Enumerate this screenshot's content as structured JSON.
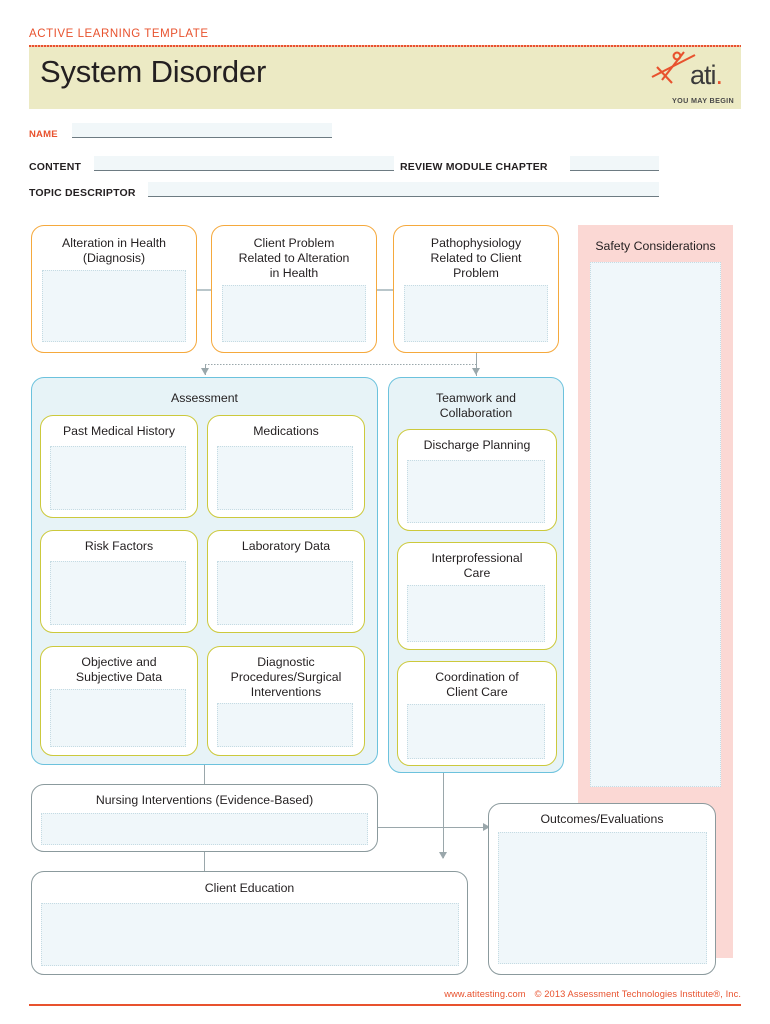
{
  "header": {
    "kicker": "ACTIVE LEARNING TEMPLATE",
    "title": "System Disorder",
    "logo_word": "ati",
    "logo_dot": ".",
    "logo_tagline": "YOU MAY BEGIN"
  },
  "form": {
    "name_label": "NAME",
    "name_value": "",
    "content_label": "CONTENT",
    "content_value": "",
    "review_label": "REVIEW MODULE CHAPTER",
    "review_value": "",
    "topic_label": "TOPIC DESCRIPTOR",
    "topic_value": ""
  },
  "top_row": [
    {
      "title": "Alteration in Health\n(Diagnosis)",
      "value": ""
    },
    {
      "title": "Client Problem\nRelated to Alteration\nin Health",
      "value": ""
    },
    {
      "title": "Pathophysiology\nRelated to Client\nProblem",
      "value": ""
    }
  ],
  "assessment": {
    "title": "Assessment",
    "boxes": [
      {
        "title": "Past Medical History",
        "value": ""
      },
      {
        "title": "Medications",
        "value": ""
      },
      {
        "title": "Risk Factors",
        "value": ""
      },
      {
        "title": "Laboratory Data",
        "value": ""
      },
      {
        "title": "Objective and\nSubjective Data",
        "value": ""
      },
      {
        "title": "Diagnostic\nProcedures/Surgical\nInterventions",
        "value": ""
      }
    ]
  },
  "teamwork": {
    "title": "Teamwork and\nCollaboration",
    "boxes": [
      {
        "title": "Discharge Planning",
        "value": ""
      },
      {
        "title": "Interprofessional\nCare",
        "value": ""
      },
      {
        "title": "Coordination of\nClient Care",
        "value": ""
      }
    ]
  },
  "safety": {
    "title": "Safety Considerations",
    "value": ""
  },
  "bottom": {
    "nursing_interventions": {
      "title": "Nursing Interventions (Evidence-Based)",
      "value": ""
    },
    "client_education": {
      "title": "Client Education",
      "value": ""
    },
    "outcomes": {
      "title": "Outcomes/Evaluations",
      "value": ""
    }
  },
  "footer": {
    "website": "www.atitesting.com",
    "copyright": "© 2013 Assessment Technologies Institute®, Inc."
  },
  "colors": {
    "accent_red": "#e8522e",
    "band_yellow": "#eceac4",
    "orange_border": "#f5a93d",
    "olive_border": "#ccc93c",
    "blue_border": "#6cc2dd",
    "group_bg": "#e7f3f7",
    "fill_blue": "#f0f7fa",
    "safety_pink": "#fbd8d4",
    "gray_border": "#8b9a9d"
  }
}
